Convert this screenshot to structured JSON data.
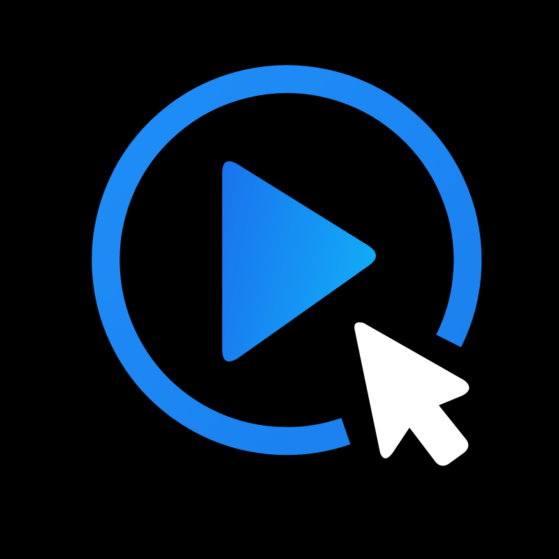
{
  "logo": {
    "icon": "play-click-icon",
    "parts": [
      {
        "name": "progress-ring-icon",
        "color": "#1e88f5",
        "description_style": "open ring with gap at lower right"
      },
      {
        "name": "play-triangle-icon",
        "gradient": [
          "#1a73ee",
          "#12a8f7"
        ]
      },
      {
        "name": "mouse-cursor-icon",
        "color": "#ffffff"
      }
    ],
    "background_color": "#000000"
  }
}
